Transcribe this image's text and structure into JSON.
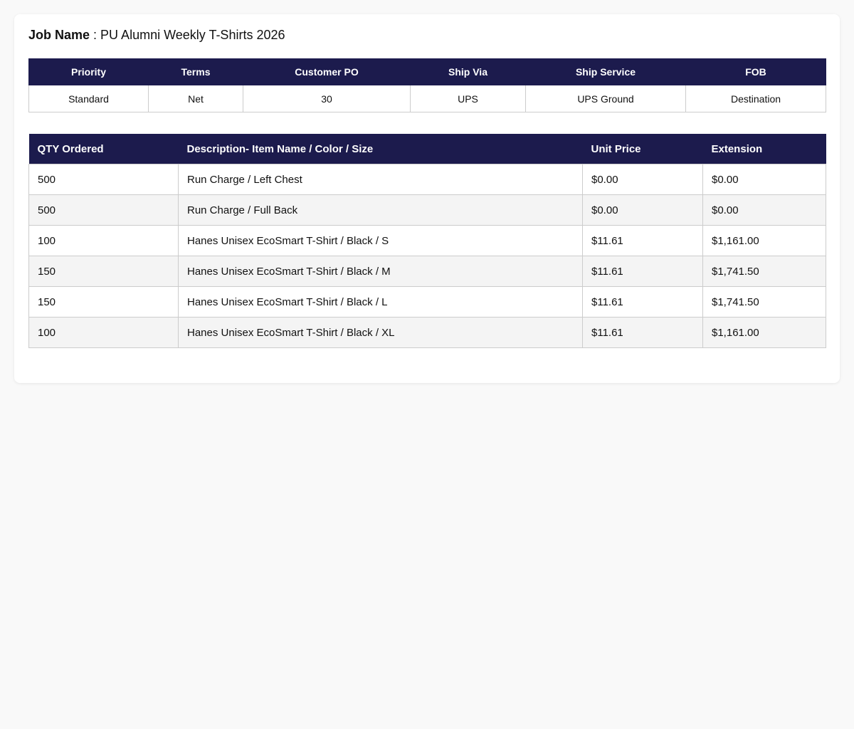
{
  "job": {
    "label": "Job Name",
    "separator": " : ",
    "value": "PU Alumni Weekly T-Shirts 2026"
  },
  "order_info": {
    "headers": [
      "Priority",
      "Terms",
      "Customer PO",
      "Ship Via",
      "Ship Service",
      "FOB"
    ],
    "values": [
      "Standard",
      "Net",
      "30",
      "UPS",
      "UPS Ground",
      "Destination"
    ]
  },
  "line_items": {
    "headers": [
      "QTY Ordered",
      "Description- Item Name / Color / Size",
      "Unit Price",
      "Extension"
    ],
    "rows": [
      {
        "qty": "500",
        "description": "Run Charge / Left Chest",
        "unit_price": "$0.00",
        "extension": "$0.00"
      },
      {
        "qty": "500",
        "description": "Run Charge / Full Back",
        "unit_price": "$0.00",
        "extension": "$0.00"
      },
      {
        "qty": "100",
        "description": "Hanes Unisex EcoSmart T-Shirt / Black / S",
        "unit_price": "$11.61",
        "extension": "$1,161.00"
      },
      {
        "qty": "150",
        "description": "Hanes Unisex EcoSmart T-Shirt / Black / M",
        "unit_price": "$11.61",
        "extension": "$1,741.50"
      },
      {
        "qty": "150",
        "description": "Hanes Unisex EcoSmart T-Shirt / Black / L",
        "unit_price": "$11.61",
        "extension": "$1,741.50"
      },
      {
        "qty": "100",
        "description": "Hanes Unisex EcoSmart T-Shirt / Black / XL",
        "unit_price": "$11.61",
        "extension": "$1,161.00"
      }
    ]
  },
  "colors": {
    "header_bg": "#1c1b4d",
    "header_text": "#ffffff",
    "stripe": "#f4f4f4",
    "border": "#cccccc"
  }
}
